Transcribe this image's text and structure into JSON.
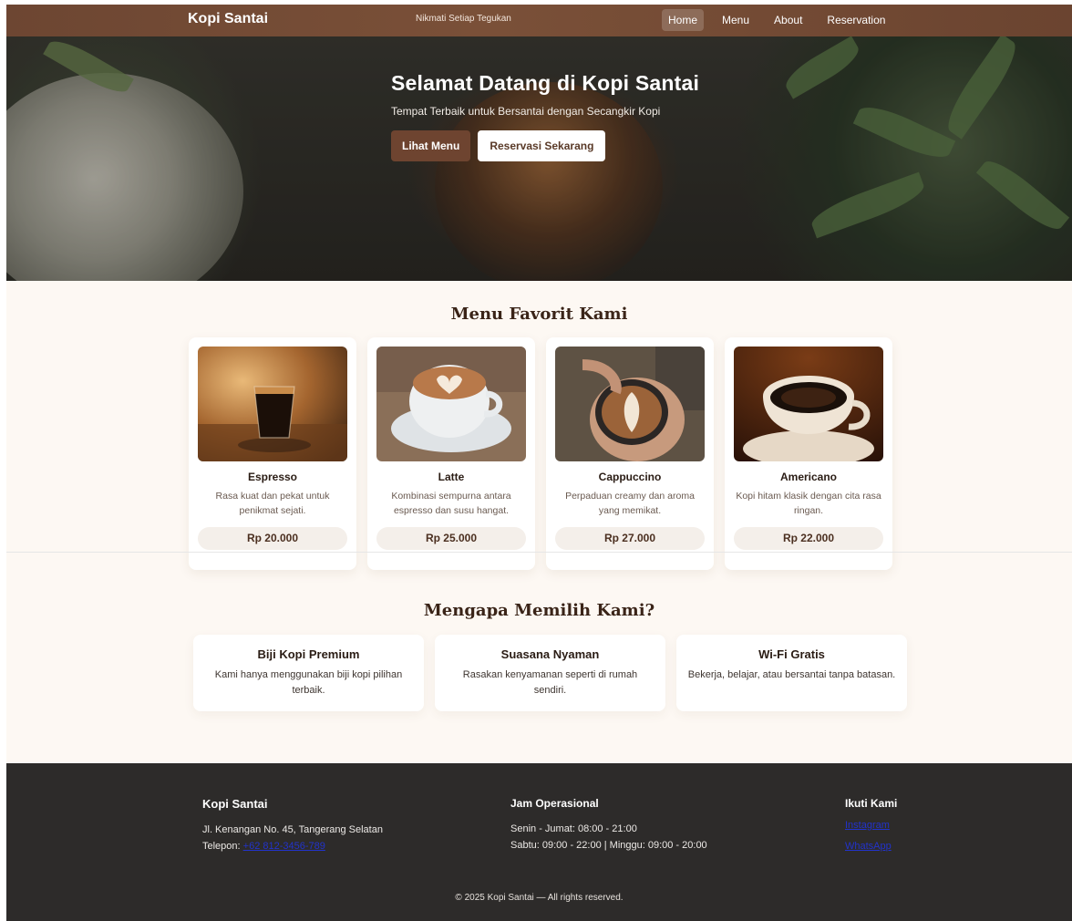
{
  "nav": {
    "brand": "Kopi Santai",
    "tagline": "Nikmati Setiap Tegukan",
    "links": [
      {
        "label": "Home",
        "active": true
      },
      {
        "label": "Menu",
        "active": false
      },
      {
        "label": "About",
        "active": false
      },
      {
        "label": "Reservation",
        "active": false
      }
    ]
  },
  "hero": {
    "title": "Selamat Datang di Kopi Santai",
    "subtitle": "Tempat Terbaik untuk Bersantai dengan Secangkir Kopi",
    "primary_button": "Lihat Menu",
    "secondary_button": "Reservasi Sekarang"
  },
  "menu": {
    "title": "Menu Favorit Kami",
    "items": [
      {
        "name": "Espresso",
        "desc": "Rasa kuat dan pekat untuk penikmat sejati.",
        "price": "Rp 20.000"
      },
      {
        "name": "Latte",
        "desc": "Kombinasi sempurna antara espresso dan susu hangat.",
        "price": "Rp 25.000"
      },
      {
        "name": "Cappuccino",
        "desc": "Perpaduan creamy dan aroma yang memikat.",
        "price": "Rp 27.000"
      },
      {
        "name": "Americano",
        "desc": "Kopi hitam klasik dengan cita rasa ringan.",
        "price": "Rp 22.000"
      }
    ]
  },
  "why": {
    "title": "Mengapa Memilih Kami?",
    "items": [
      {
        "name": "Biji Kopi Premium",
        "desc": "Kami hanya menggunakan biji kopi pilihan terbaik."
      },
      {
        "name": "Suasana Nyaman",
        "desc": "Rasakan kenyamanan seperti di rumah sendiri."
      },
      {
        "name": "Wi-Fi Gratis",
        "desc": "Bekerja, belajar, atau bersantai tanpa batasan."
      }
    ]
  },
  "footer": {
    "brand": "Kopi Santai",
    "address": "Jl. Kenangan No. 45, Tangerang Selatan",
    "phone_label": "Telepon: ",
    "phone": "+62 812-3456-789",
    "hours_title": "Jam Operasional",
    "hours_weekday": "Senin - Jumat: 08:00 - 21:00",
    "hours_weekend": "Sabtu: 09:00 - 22:00 | Minggu: 09:00 - 20:00",
    "social_title": "Ikuti Kami",
    "social_links": [
      "Instagram",
      "WhatsApp"
    ],
    "copyright": "© 2025 Kopi Santai — All rights reserved."
  },
  "colors": {
    "brand_brown": "#6e4430",
    "page_bg": "#fdf8f3",
    "footer_bg": "#2d2b2a"
  }
}
